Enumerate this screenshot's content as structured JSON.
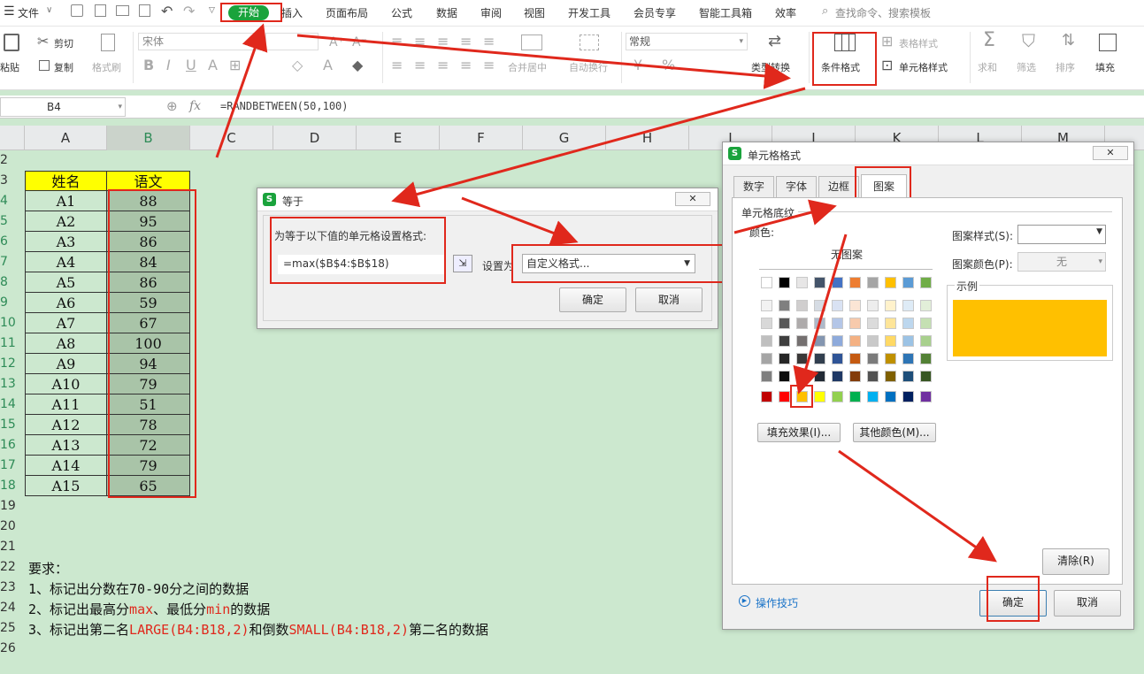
{
  "menubar": {
    "file_label": "文件",
    "start_label": "开始",
    "items": [
      "插入",
      "页面布局",
      "公式",
      "数据",
      "审阅",
      "视图",
      "开发工具",
      "会员专享",
      "智能工具箱",
      "效率"
    ],
    "search_placeholder": "查找命令、搜索模板"
  },
  "ribbon": {
    "paste": "粘贴",
    "cut": "剪切",
    "copy": "复制",
    "format_painter": "格式刷",
    "font_name": "宋体",
    "merge_center": "合并居中",
    "auto_wrap": "自动换行",
    "number_format": "常规",
    "type_convert": "类型转换",
    "conditional_format": "条件格式",
    "table_style": "表格样式",
    "cell_style": "单元格样式",
    "sum": "求和",
    "filter": "筛选",
    "sort": "排序",
    "fill": "填充"
  },
  "formula_bar": {
    "name_box": "B4",
    "fx": "fx",
    "formula": "=RANDBETWEEN(50,100)"
  },
  "grid": {
    "columns": [
      "A",
      "B",
      "C",
      "D",
      "E",
      "F",
      "G",
      "H",
      "I",
      "J",
      "K",
      "L",
      "M"
    ],
    "rows": [
      "2",
      "3",
      "4",
      "5",
      "6",
      "7",
      "8",
      "9",
      "10",
      "11",
      "12",
      "13",
      "14",
      "15",
      "16",
      "17",
      "18",
      "19",
      "20",
      "21",
      "22",
      "23",
      "24",
      "25",
      "26"
    ],
    "header": {
      "name": "姓名",
      "score": "语文"
    },
    "data": [
      {
        "name": "A1",
        "score": "88"
      },
      {
        "name": "A2",
        "score": "95"
      },
      {
        "name": "A3",
        "score": "86"
      },
      {
        "name": "A4",
        "score": "84"
      },
      {
        "name": "A5",
        "score": "86"
      },
      {
        "name": "A6",
        "score": "59"
      },
      {
        "name": "A7",
        "score": "67"
      },
      {
        "name": "A8",
        "score": "100"
      },
      {
        "name": "A9",
        "score": "94"
      },
      {
        "name": "A10",
        "score": "79"
      },
      {
        "name": "A11",
        "score": "51"
      },
      {
        "name": "A12",
        "score": "78"
      },
      {
        "name": "A13",
        "score": "72"
      },
      {
        "name": "A14",
        "score": "79"
      },
      {
        "name": "A15",
        "score": "65"
      }
    ]
  },
  "requirements": {
    "title": "要求：",
    "line1": "1、标记出分数在70-90分之间的数据",
    "line2_a": "2、标记出最高分",
    "line2_b": "max",
    "line2_c": "、最低分",
    "line2_d": "min",
    "line2_e": "的数据",
    "line3_a": "3、标记出第二名",
    "line3_b": "LARGE(B4:B18,2)",
    "line3_c": "和倒数",
    "line3_d": "SMALL(B4:B18,2)",
    "line3_e": "第二名的数据"
  },
  "equal_dialog": {
    "title": "等于",
    "prompt": "为等于以下值的单元格设置格式:",
    "value": "=max($B$4:$B$18)",
    "set_as_label": "设置为",
    "set_as_value": "自定义格式...",
    "ok": "确定",
    "cancel": "取消"
  },
  "format_dialog": {
    "title": "单元格格式",
    "tabs": [
      "数字",
      "字体",
      "边框",
      "图案"
    ],
    "active_tab": "图案",
    "section": "单元格底纹",
    "color_label": "颜色:",
    "no_pattern": "无图案",
    "pattern_style_label": "图案样式(S):",
    "pattern_color_label": "图案颜色(P):",
    "pattern_color_value": "无",
    "sample_label": "示例",
    "sample_color": "#ffc000",
    "fill_effects": "填充效果(I)...",
    "more_colors": "其他颜色(M)...",
    "clear": "清除(R)",
    "tips": "操作技巧",
    "ok": "确定",
    "cancel": "取消",
    "palette_top": [
      "#ffffff",
      "#000000",
      "#e7e6e6",
      "#44546a",
      "#4472c4",
      "#ed7d31",
      "#a5a5a5",
      "#ffc000",
      "#5b9bd5",
      "#70ad47"
    ],
    "palette_shades": [
      [
        "#f2f2f2",
        "#7f7f7f",
        "#d0cece",
        "#d6dce4",
        "#d9e2f3",
        "#fbe5d5",
        "#ededed",
        "#fff2cc",
        "#deebf6",
        "#e2efd9"
      ],
      [
        "#d8d8d8",
        "#595959",
        "#aeabab",
        "#adb9ca",
        "#b4c6e7",
        "#f7caac",
        "#dbdbdb",
        "#fee599",
        "#bdd7ee",
        "#c5e0b3"
      ],
      [
        "#bfbfbf",
        "#3f3f3f",
        "#757070",
        "#8496b0",
        "#8eaadb",
        "#f4b183",
        "#c9c9c9",
        "#ffd965",
        "#9cc3e5",
        "#a8d08d"
      ],
      [
        "#a5a5a5",
        "#262626",
        "#3a3838",
        "#323f4f",
        "#2f5496",
        "#c55a11",
        "#7b7b7b",
        "#bf9000",
        "#2e75b5",
        "#538135"
      ],
      [
        "#7f7f7f",
        "#0c0c0c",
        "#171616",
        "#222a35",
        "#1f3864",
        "#833c0b",
        "#525252",
        "#7f6000",
        "#1e4e79",
        "#375623"
      ]
    ],
    "palette_standard": [
      "#c00000",
      "#ff0000",
      "#ffc000",
      "#ffff00",
      "#92d050",
      "#00b050",
      "#00b0f0",
      "#0070c0",
      "#002060",
      "#7030a0"
    ]
  },
  "colors": {
    "sheet_bg": "#cce8cf",
    "highlight_red": "#e0281c",
    "wps_green": "#1aa33c"
  }
}
